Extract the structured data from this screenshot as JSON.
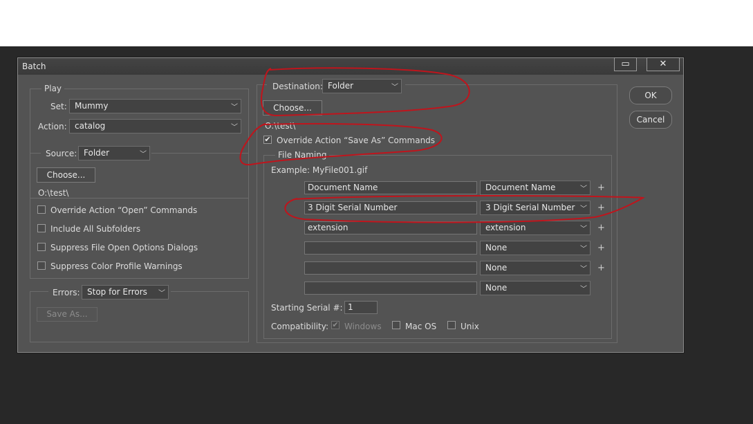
{
  "dialog": {
    "title": "Batch",
    "restore_glyph": "▭",
    "close_glyph": "✕"
  },
  "play": {
    "legend": "Play",
    "set_label": "Set:",
    "set_value": "Mummy",
    "action_label": "Action:",
    "action_value": "catalog"
  },
  "source": {
    "label": "Source:",
    "value": "Folder",
    "choose_label": "Choose...",
    "path": "O:\\test\\",
    "options": [
      "Override Action “Open” Commands",
      "Include All Subfolders",
      "Suppress File Open Options Dialogs",
      "Suppress Color Profile Warnings"
    ]
  },
  "errors": {
    "label": "Errors:",
    "value": "Stop for Errors",
    "save_as_label": "Save As..."
  },
  "destination": {
    "label": "Destination:",
    "value": "Folder",
    "choose_label": "Choose...",
    "path": "O:\\test\\",
    "override_label": "Override Action “Save As” Commands",
    "override_checked": true
  },
  "file_naming": {
    "legend": "File Naming",
    "example": "Example: MyFile001.gif",
    "rows": [
      {
        "text": "Document Name",
        "select": "Document Name",
        "plus": "+"
      },
      {
        "text": "3 Digit Serial Number",
        "select": "3 Digit Serial Number",
        "plus": "+"
      },
      {
        "text": "extension",
        "select": "extension",
        "plus": "+"
      },
      {
        "text": "",
        "select": "None",
        "plus": "+"
      },
      {
        "text": "",
        "select": "None",
        "plus": "+"
      },
      {
        "text": "",
        "select": "None",
        "plus": ""
      }
    ],
    "serial_label": "Starting Serial #:",
    "serial_value": "1",
    "compat_label": "Compatibility:",
    "compat": [
      {
        "label": "Windows",
        "checked": true,
        "disabled": true
      },
      {
        "label": "Mac OS",
        "checked": false,
        "disabled": false
      },
      {
        "label": "Unix",
        "checked": false,
        "disabled": false
      }
    ]
  },
  "buttons": {
    "ok": "OK",
    "cancel": "Cancel"
  },
  "icons": {
    "dropdown": "chevron-down-icon",
    "check": "checkmark-icon"
  },
  "colors": {
    "annotation": "#c0141c",
    "dialog_bg": "#535353",
    "backdrop": "#282828"
  }
}
